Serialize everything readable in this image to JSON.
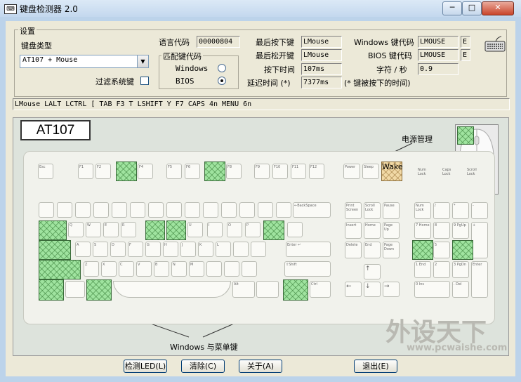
{
  "window": {
    "title": "键盘检测器 2.0",
    "min_glyph": "─",
    "max_glyph": "□",
    "close_glyph": "✕"
  },
  "settings": {
    "group_label": "设置",
    "kb_type_label": "键盘类型",
    "kb_type_value": "AT107 + Mouse",
    "filter_label": "过滤系统键",
    "filter_checked": false
  },
  "language": {
    "label": "语言代码",
    "value": "00000804"
  },
  "match": {
    "label": "匹配键代码",
    "options": [
      "Windows",
      "BIOS"
    ],
    "selected": "BIOS"
  },
  "info": {
    "last_press_label": "最后按下键",
    "last_press_value": "LMouse",
    "last_release_label": "最后松开键",
    "last_release_value": "LMouse",
    "press_time_label": "按下时间",
    "press_time_value": "107ms",
    "delay_label": "延迟时间 (*)",
    "delay_value": "7377ms",
    "delay_note": "(* 键被按下的时间)",
    "win_code_label": "Windows 键代码",
    "win_code_value": "LMOUSE",
    "win_code_ext": "E",
    "bios_code_label": "BIOS 键代码",
    "bios_code_value": "LMOUSE",
    "bios_code_ext": "E",
    "rate_label": "字符 / 秒",
    "rate_value": "0.9"
  },
  "log_line": "LMouse LALT LCTRL [ TAB F3 T LSHIFT Y F7 CAPS 4n MENU 6n",
  "keyboard": {
    "model_label": "AT107",
    "power_label": "电源管理",
    "winmenu_label": "Windows 与菜单键",
    "pressed_keys": [
      "LMouse",
      "LALT",
      "LCTRL",
      "[",
      "TAB",
      "F3",
      "T",
      "LSHIFT",
      "Y",
      "F7",
      "CAPS",
      "4n",
      "MENU",
      "6n",
      "POWER"
    ],
    "key_labels": {
      "esc": "Esc",
      "f1": "F1",
      "f2": "F2",
      "f4": "F4",
      "f5": "F5",
      "f6": "F6",
      "f8": "F8",
      "f9": "F9",
      "f10": "F10",
      "f11": "F11",
      "f12": "F12",
      "power": "Power",
      "sleep": "Sleep",
      "wake": "Wake",
      "num_lock_led": "Num Lock",
      "caps_lock_led": "Caps Lock",
      "scroll_lock_led": "Scroll Lock",
      "q": "Q",
      "w": "W",
      "e": "E",
      "r": "R",
      "u": "U",
      "i": "I",
      "o": "O",
      "p": "P",
      "a": "A",
      "s": "S",
      "d": "D",
      "f": "F",
      "g": "G",
      "h": "H",
      "j": "J",
      "k": "K",
      "l": "L",
      "z": "Z",
      "x": "X",
      "c": "C",
      "v": "V",
      "b": "B",
      "n": "N",
      "m": "M",
      "bksp": "←BackSpace",
      "enter": "Enter ↵",
      "shift": "⇧Shift",
      "alt": "Alt",
      "ctrl": "Ctrl",
      "print_screen": "Print Screen",
      "scroll_lock": "Scroll Lock",
      "pause": "Pause",
      "insert": "Insert",
      "home": "Home",
      "page_up": "Page Up",
      "delete": "Delete",
      "end": "End",
      "page_down": "Page Down",
      "arrow_up": "↑",
      "arrow_left": "←",
      "arrow_down": "↓",
      "arrow_right": "→",
      "np_num_lock": "Num Lock",
      "np_div": "/",
      "np_mul": "*",
      "np_minus": "-",
      "np7": "7 Home",
      "np8": "8",
      "np9": "9 PgUp",
      "np_plus": "+",
      "np5": "5",
      "np1": "1 End",
      "np2": "2",
      "np3": "3 PgDn",
      "np0": "0 Ins",
      "np_dot": ". Del",
      "np_enter": "Enter"
    }
  },
  "buttons": {
    "led": "检测LED(L)",
    "clear": "清除(C)",
    "about": "关于(A)",
    "exit": "退出(E)"
  },
  "watermark": {
    "brand": "外设天下",
    "url": "www.pcwaishe.com"
  }
}
